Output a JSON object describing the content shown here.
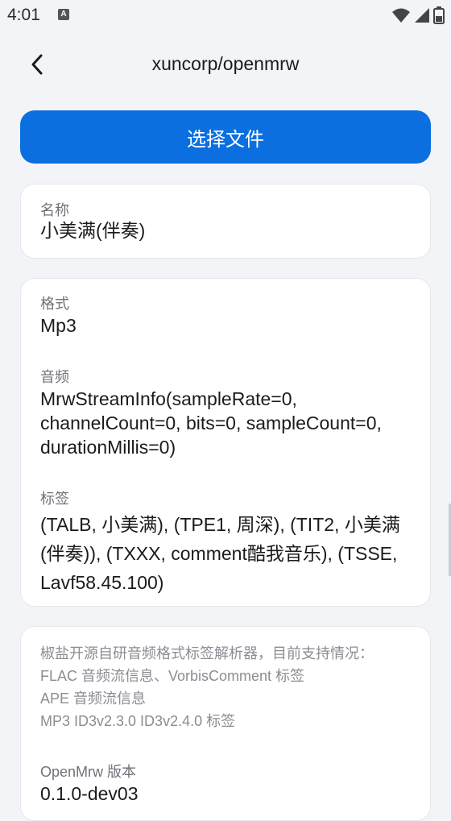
{
  "status_bar": {
    "time": "4:01",
    "notification_icon": "a-letter-icon",
    "icons": [
      "wifi-icon",
      "cellular-signal-icon",
      "battery-icon"
    ]
  },
  "app_bar": {
    "back_icon": "back-arrow-icon",
    "title": "xuncorp/openmrw"
  },
  "select_file_button": {
    "label": "选择文件",
    "color": "#0b6fe0"
  },
  "name_card": {
    "label": "名称",
    "value": "小美满(伴奏)"
  },
  "details_card": {
    "format_label": "格式",
    "format_value": "Mp3",
    "audio_label": "音频",
    "audio_value": "MrwStreamInfo(sampleRate=0, channelCount=0, bits=0, sampleCount=0, durationMillis=0)",
    "tags_label": "标签",
    "tags_value": "(TALB, 小美满), (TPE1, 周深), (TIT2, 小美满(伴奏)), (TXXX, comment酷我音乐), (TSSE, Lavf58.45.100)"
  },
  "about_card": {
    "description": "椒盐开源自研音频格式标签解析器，目前支持情况：\nFLAC 音频流信息、VorbisComment 标签\nAPE 音频流信息\nMP3 ID3v2.3.0 ID3v2.4.0 标签",
    "version_label": "OpenMrw 版本",
    "version_value": "0.1.0-dev03"
  }
}
